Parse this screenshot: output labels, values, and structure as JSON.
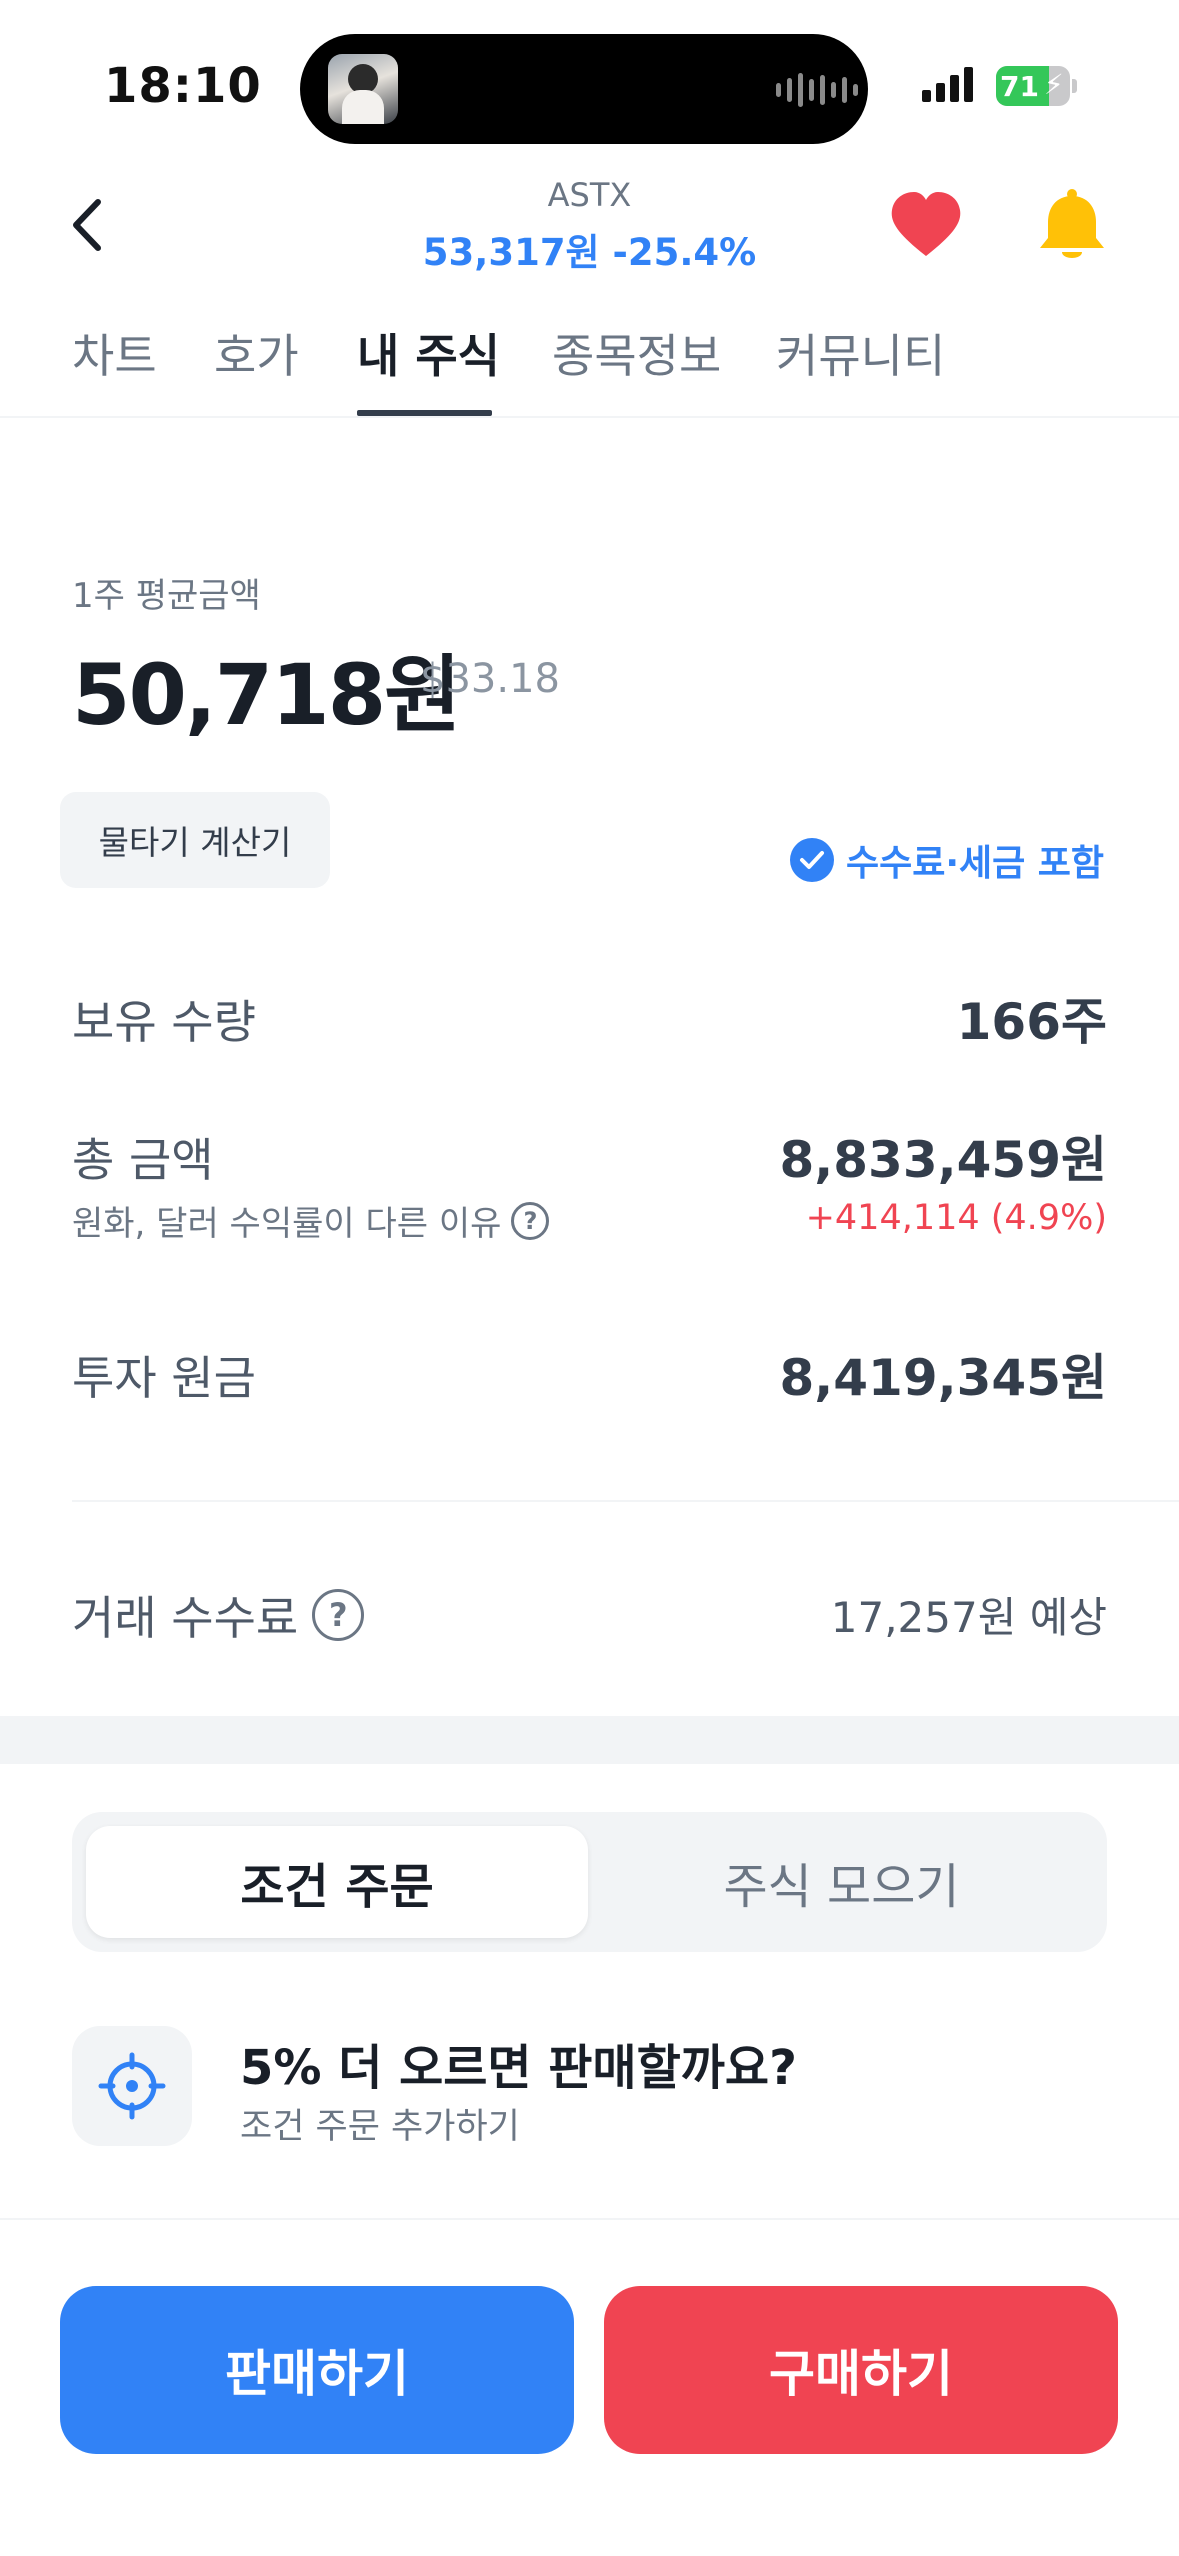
{
  "status_bar": {
    "time": "18:10",
    "battery": "71",
    "battery_level": 0.71
  },
  "header": {
    "ticker": "ASTX",
    "price_line": "53,317원 -25.4%",
    "icons": [
      "chevron-left-icon",
      "heart-icon",
      "bell-icon"
    ]
  },
  "tabs": [
    "차트",
    "호가",
    "내 주식",
    "종목정보",
    "커뮤니티"
  ],
  "active_tab": "내 주식",
  "avg": {
    "label": "1주 평균금액",
    "price": "50,718원",
    "usd": "$33.18"
  },
  "calculator_button": "물타기 계산기",
  "fee_included": "수수료·세금 포함",
  "holdings": {
    "quantity_label": "보유 수량",
    "quantity_value": "166주",
    "total_label": "총 금액",
    "total_value": "8,833,459원",
    "total_sub": "원화, 달러 수익률이 다른 이유",
    "profit": "+414,114 (4.9%)",
    "principal_label": "투자 원금",
    "principal_value": "8,419,345원",
    "fee_label": "거래 수수료",
    "fee_value": "17,257원 예상"
  },
  "segment": {
    "active": "조건 주문",
    "other": "주식 모으기"
  },
  "conditional": {
    "title": "5% 더 오르면 판매할까요?",
    "subtitle": "조건 주문 추가하기"
  },
  "buttons": {
    "sell": "판매하기",
    "buy": "구매하기"
  },
  "colors": {
    "accent_blue": "#3182f6",
    "accent_red": "#f04452",
    "heart": "#f04452",
    "bell": "#ffc107"
  }
}
